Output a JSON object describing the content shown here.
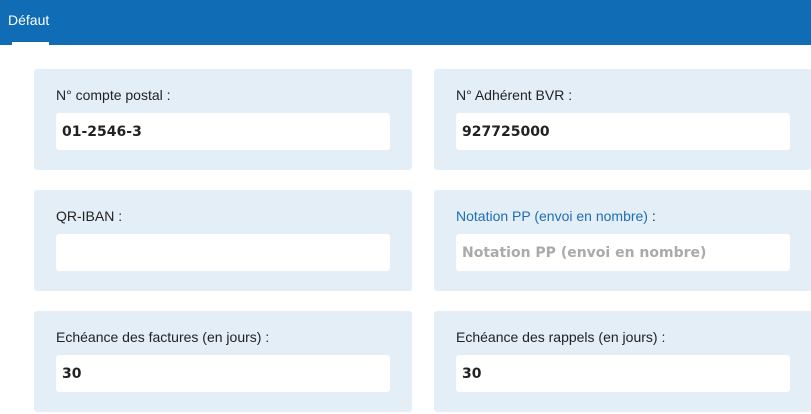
{
  "tabs": [
    {
      "label": "Défaut",
      "active": true
    }
  ],
  "colors": {
    "header": "#0f6cb5",
    "card_background": "#e3eef7",
    "link": "#1f6db3"
  },
  "fields": {
    "postal_account": {
      "label": "N° compte postal :",
      "value": "01-2546-3"
    },
    "bvr_member": {
      "label": "N° Adhérent BVR :",
      "value": "927725000"
    },
    "qr_iban": {
      "label": "QR-IBAN :",
      "value": ""
    },
    "pp_notation": {
      "label_link": "Notation PP (envoi en nombre)",
      "label_suffix": " :",
      "value": "",
      "placeholder": "Notation PP (envoi en nombre)"
    },
    "invoice_due": {
      "label": "Echéance des factures (en jours) :",
      "value": "30"
    },
    "reminder_due": {
      "label": "Echéance des rappels (en jours) :",
      "value": "30"
    }
  }
}
